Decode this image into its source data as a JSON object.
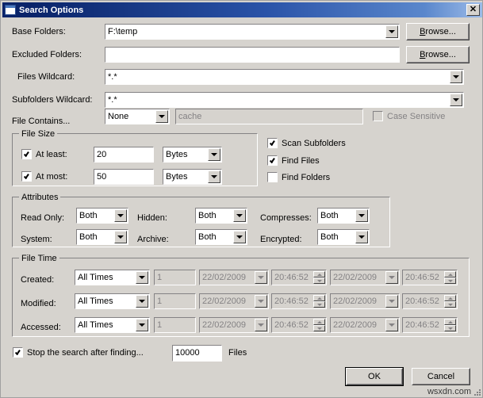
{
  "window": {
    "title": "Search Options",
    "icon": "folder-search-icon",
    "close_label": "✕",
    "watermark": "wsxdn.com"
  },
  "top_fields": {
    "base_folders": {
      "label": "Base Folders:",
      "value": "F:\\temp",
      "browse_label_pre": "B",
      "browse_label_post": "rowse..."
    },
    "excluded_folders": {
      "label": "Excluded Folders:",
      "value": "",
      "browse_label_pre": "B",
      "browse_label_post": "rowse..."
    },
    "files_wildcard": {
      "label": "Files Wildcard:",
      "value": "*.*"
    },
    "subfolders_wildcard": {
      "label": "Subfolders Wildcard:",
      "value": "*.*"
    },
    "file_contains": {
      "label": "File Contains...",
      "mode": "None",
      "text_placeholder": "cache",
      "case_sensitive_label": "Case Sensitive",
      "case_sensitive_checked": false,
      "case_sensitive_enabled": false
    }
  },
  "file_size": {
    "title": "File Size",
    "at_least": {
      "label": "At least:",
      "checked": true,
      "value": "20",
      "unit": "Bytes"
    },
    "at_most": {
      "label": "At most:",
      "checked": true,
      "value": "50",
      "unit": "Bytes"
    }
  },
  "scan_options": [
    {
      "label": "Scan Subfolders",
      "checked": true
    },
    {
      "label": "Find Files",
      "checked": true
    },
    {
      "label": "Find Folders",
      "checked": false
    }
  ],
  "attributes": {
    "title": "Attributes",
    "rows": [
      {
        "label": "Read Only:",
        "value": "Both"
      },
      {
        "label": "Hidden:",
        "value": "Both"
      },
      {
        "label": "Compresses:",
        "value": "Both"
      },
      {
        "label": "System:",
        "value": "Both"
      },
      {
        "label": "Archive:",
        "value": "Both"
      },
      {
        "label": "Encrypted:",
        "value": "Both"
      }
    ]
  },
  "file_time": {
    "title": "File Time",
    "rows": [
      {
        "label": "Created:",
        "mode": "All Times",
        "count": "1",
        "date_from": "22/02/2009",
        "time_from": "20:46:52",
        "date_to": "22/02/2009",
        "time_to": "20:46:52"
      },
      {
        "label": "Modified:",
        "mode": "All Times",
        "count": "1",
        "date_from": "22/02/2009",
        "time_from": "20:46:52",
        "date_to": "22/02/2009",
        "time_to": "20:46:52"
      },
      {
        "label": "Accessed:",
        "mode": "All Times",
        "count": "1",
        "date_from": "22/02/2009",
        "time_from": "20:46:52",
        "date_to": "22/02/2009",
        "time_to": "20:46:52"
      }
    ]
  },
  "stop_search": {
    "label": "Stop the search after finding...",
    "checked": true,
    "value": "10000",
    "unit_label": "Files"
  },
  "footer": {
    "ok_label": "OK",
    "cancel_label": "Cancel"
  }
}
